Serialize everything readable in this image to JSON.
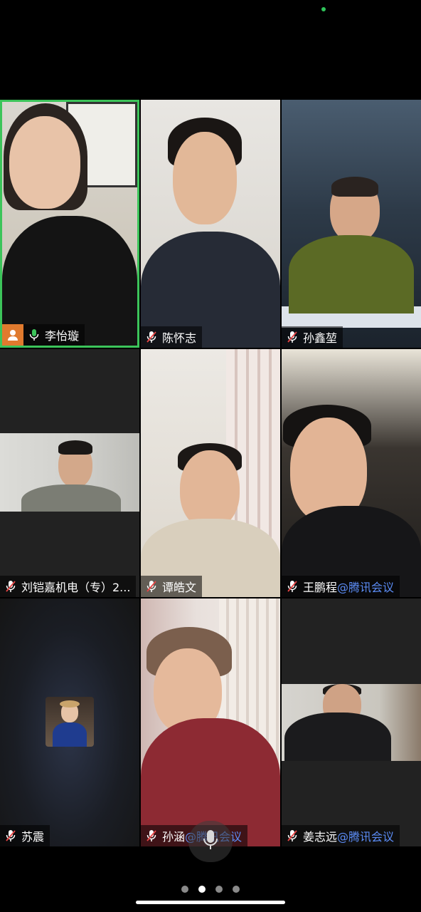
{
  "participants": [
    {
      "name": "李怡璇",
      "suffix": "",
      "mic": "on",
      "host": true
    },
    {
      "name": "陈怀志",
      "suffix": "",
      "mic": "muted",
      "host": false
    },
    {
      "name": "孙鑫堃",
      "suffix": "",
      "mic": "muted",
      "host": false
    },
    {
      "name": "刘铠嘉机电（专）2...",
      "suffix": "",
      "mic": "muted",
      "host": false
    },
    {
      "name": "谭皓文",
      "suffix": "",
      "mic": "muted",
      "host": false
    },
    {
      "name": "王鹏程",
      "suffix": "@腾讯会议",
      "mic": "muted",
      "host": false
    },
    {
      "name": "苏震",
      "suffix": "",
      "mic": "muted",
      "host": false
    },
    {
      "name": "孙涵",
      "suffix": "@腾讯会议",
      "mic": "muted",
      "host": false
    },
    {
      "name": "姜志远",
      "suffix": "@腾讯会议",
      "mic": "muted",
      "host": false
    }
  ],
  "pager": {
    "pages": 4,
    "current": 2
  },
  "colors": {
    "active_border": "#3cc45a",
    "brand_suffix": "#5b8cf5",
    "host_badge": "#e07a2e"
  },
  "icons": {
    "mic_on": "mic-icon",
    "mic_muted": "mic-muted-icon",
    "host": "host-icon",
    "floating_mic": "mic-icon"
  }
}
